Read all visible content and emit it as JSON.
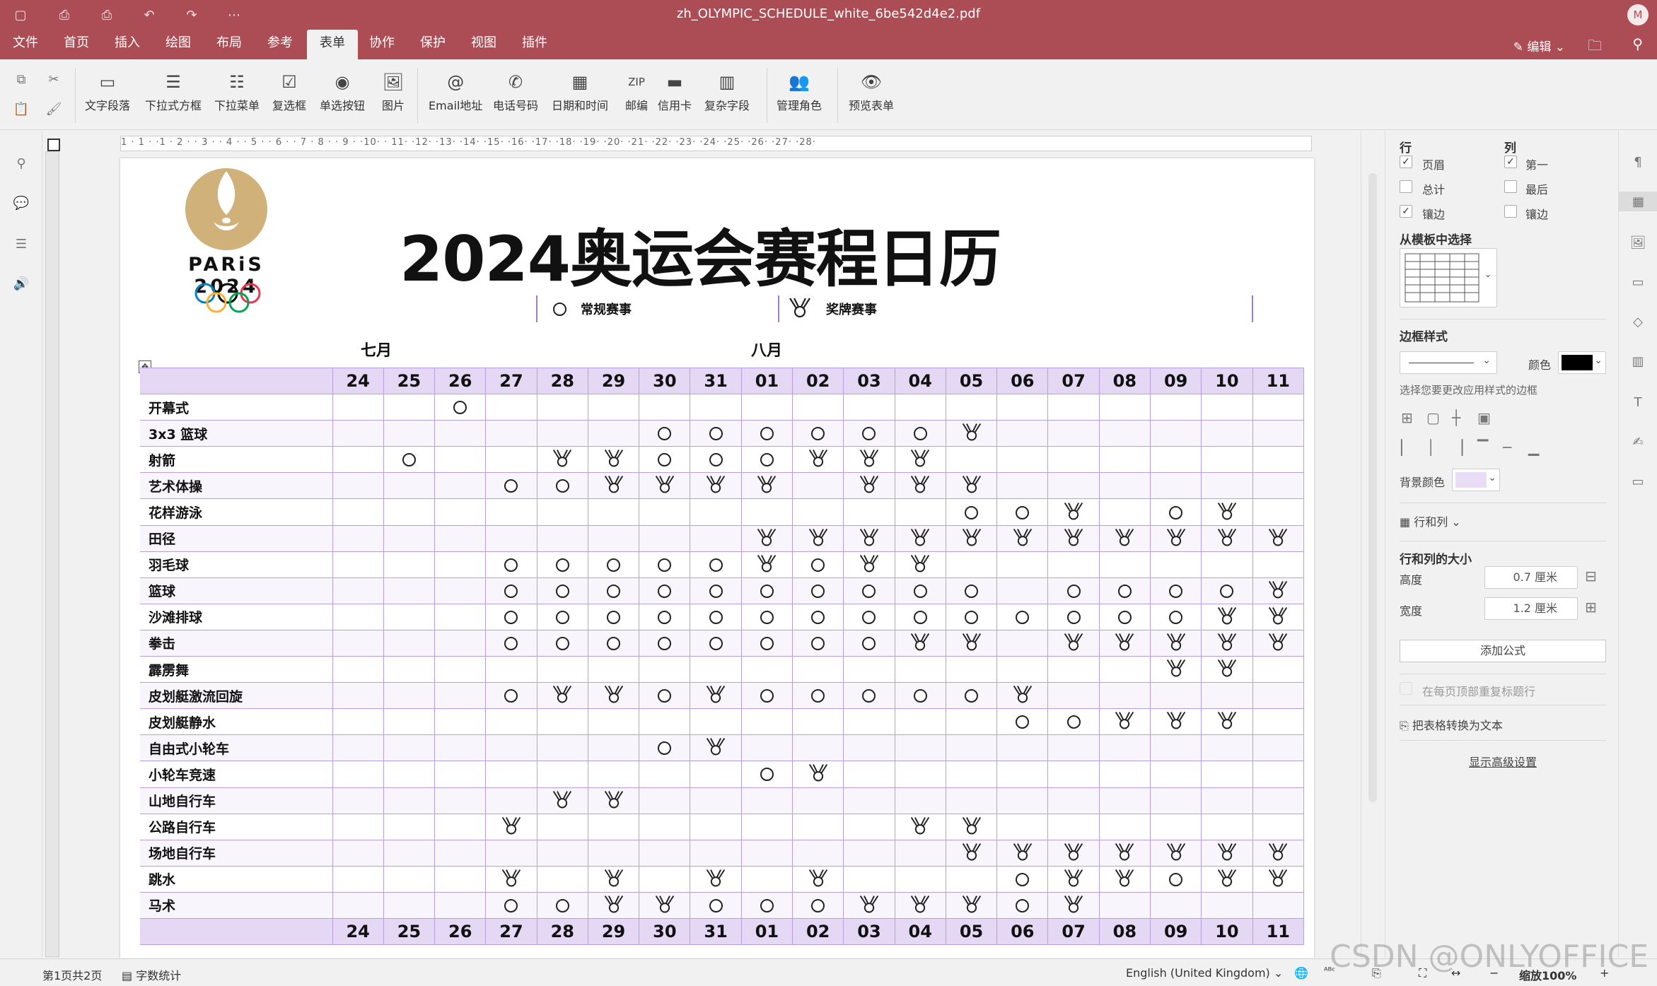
{
  "window": {
    "title": "zh_OLYMPIC_SCHEDULE_white_6be542d4e2.pdf",
    "avatar_initial": "M",
    "accent": "#ac4d55"
  },
  "menu": {
    "tabs": [
      "文件",
      "首页",
      "插入",
      "绘图",
      "布局",
      "参考",
      "表单",
      "协作",
      "保护",
      "视图",
      "插件"
    ],
    "active_tab": "表单",
    "edit_mode_label": "编辑"
  },
  "toolbar": {
    "tools": [
      {
        "label": "文字段落",
        "icon": "text-field-icon"
      },
      {
        "label": "下拉式方框",
        "icon": "combo-box-icon"
      },
      {
        "label": "下拉菜单",
        "icon": "dropdown-list-icon"
      },
      {
        "label": "复选框",
        "icon": "checkbox-icon"
      },
      {
        "label": "单选按钮",
        "icon": "radio-button-icon"
      },
      {
        "label": "图片",
        "icon": "image-icon"
      },
      {
        "label": "Email地址",
        "icon": "email-icon"
      },
      {
        "label": "电话号码",
        "icon": "phone-icon"
      },
      {
        "label": "日期和时间",
        "icon": "calendar-icon"
      },
      {
        "label": "邮编",
        "icon": "zip-icon"
      },
      {
        "label": "信用卡",
        "icon": "credit-card-icon"
      },
      {
        "label": "复杂字段",
        "icon": "complex-field-icon"
      },
      {
        "label": "管理角色",
        "icon": "manage-roles-icon"
      },
      {
        "label": "预览表单",
        "icon": "preview-form-icon"
      }
    ]
  },
  "ruler": {
    "numbers": "1 · 1 · ·1 · 2 · · 3 · · 4 · · 5 · · 6 · · 7 · 8 · · 9 · ·10· · 11· ·12· ·13· ·14· ·15· ·16· ·17· ·18· ·19· ·20· ·21· ·22· ·23· ·24· ·25· ·26· ·27· ·28·"
  },
  "document": {
    "logo_text": "PARiS 2024",
    "title": "2024奥运会赛程日历",
    "legend": {
      "regular_label": "常规赛事",
      "medal_label": "奖牌赛事"
    },
    "months": {
      "july": "七月",
      "august": "八月"
    }
  },
  "schedule": {
    "dates": [
      "24",
      "25",
      "26",
      "27",
      "28",
      "29",
      "30",
      "31",
      "01",
      "02",
      "03",
      "04",
      "05",
      "06",
      "07",
      "08",
      "09",
      "10",
      "11"
    ],
    "legend_codes": {
      "o": "常规赛事",
      "m": "奖牌赛事"
    },
    "rows": [
      {
        "sport": "开幕式",
        "events": "..o................o"
      },
      {
        "sport": "3x3 篮球",
        "events": "......oooooom......"
      },
      {
        "sport": "射箭",
        "events": ".o..mmooommm......."
      },
      {
        "sport": "艺术体操",
        "events": "...oommmm.mmm......"
      },
      {
        "sport": "花样游泳",
        "events": "............oom.om."
      },
      {
        "sport": "田径",
        "events": "........mmmmmmmmmmm"
      },
      {
        "sport": "羽毛球",
        "events": "...ooooomomm......."
      },
      {
        "sport": "篮球",
        "events": "...oooooooooo.oooomm"
      },
      {
        "sport": "沙滩排球",
        "events": "...oooooooooooooomm."
      },
      {
        "sport": "拳击",
        "events": "...oooooooomm.mmmmm."
      },
      {
        "sport": "霹雳舞",
        "events": "................mm."
      },
      {
        "sport": "皮划艇激流回旋",
        "events": "...ommomooooom......"
      },
      {
        "sport": "皮划艇静水",
        "events": ".............oommm."
      },
      {
        "sport": "自由式小轮车",
        "events": "......om..........."
      },
      {
        "sport": "小轮车竞速",
        "events": "........om........."
      },
      {
        "sport": "山地自行车",
        "events": "....mm............."
      },
      {
        "sport": "公路自行车",
        "events": "...m.......mm......."
      },
      {
        "sport": "场地自行车",
        "events": "............mmmmmmm"
      },
      {
        "sport": "跳水",
        "events": "...m.m.m.m...ommomm."
      },
      {
        "sport": "马术",
        "events": "...oommooommmom....."
      }
    ]
  },
  "right_panel": {
    "rows_header": "行",
    "cols_header": "列",
    "rows_opts": [
      {
        "label": "页眉",
        "checked": "✓"
      },
      {
        "label": "总计",
        "checked": ""
      },
      {
        "label": "镶边",
        "checked": "✓"
      }
    ],
    "cols_opts": [
      {
        "label": "第一",
        "checked": "✓"
      },
      {
        "label": "最后",
        "checked": ""
      },
      {
        "label": "镶边",
        "checked": ""
      }
    ],
    "template_header": "从模板中选择",
    "border_style_header": "边框样式",
    "color_label": "颜色",
    "border_color": "#000000",
    "border_hint": "选择您要更改应用样式的边框",
    "bg_color_label": "背景颜色",
    "bg_color": "#e8dcf7",
    "rows_cols_label": "行和列",
    "size_header": "行和列的大小",
    "height_label": "高度",
    "height_value": "0.7 厘米",
    "width_label": "宽度",
    "width_value": "1.2 厘米",
    "add_formula": "添加公式",
    "repeat_header": "在每页顶部重复标题行",
    "convert_text": "把表格转换为文本",
    "advanced": "显示高级设置"
  },
  "status": {
    "page": "第1页共2页",
    "word_count": "字数统计",
    "language": "English (United Kingdom)",
    "zoom": "缩放100%",
    "watermark": "CSDN @ONLYOFFICE"
  }
}
